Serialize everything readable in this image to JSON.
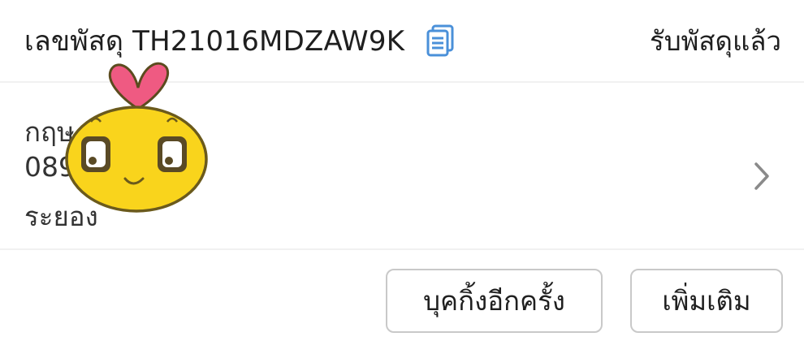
{
  "header": {
    "tracking_label": "เลขพัสดุ TH21016MDZAW9K",
    "copy_icon": "copy-icon",
    "status": "รับพัสดุแล้ว"
  },
  "address": {
    "name": "กฤษ          รววรรณ",
    "phone": "089",
    "province": "ระยอง",
    "chevron_icon": "chevron-right-icon"
  },
  "actions": {
    "rebook_label": "บุคกิ้งอีกครั้ง",
    "more_label": "เพิ่มเติม"
  },
  "colors": {
    "accent_blue": "#4a90d9",
    "mascot_yellow": "#f9d41c",
    "mascot_pink": "#ef5a82"
  }
}
